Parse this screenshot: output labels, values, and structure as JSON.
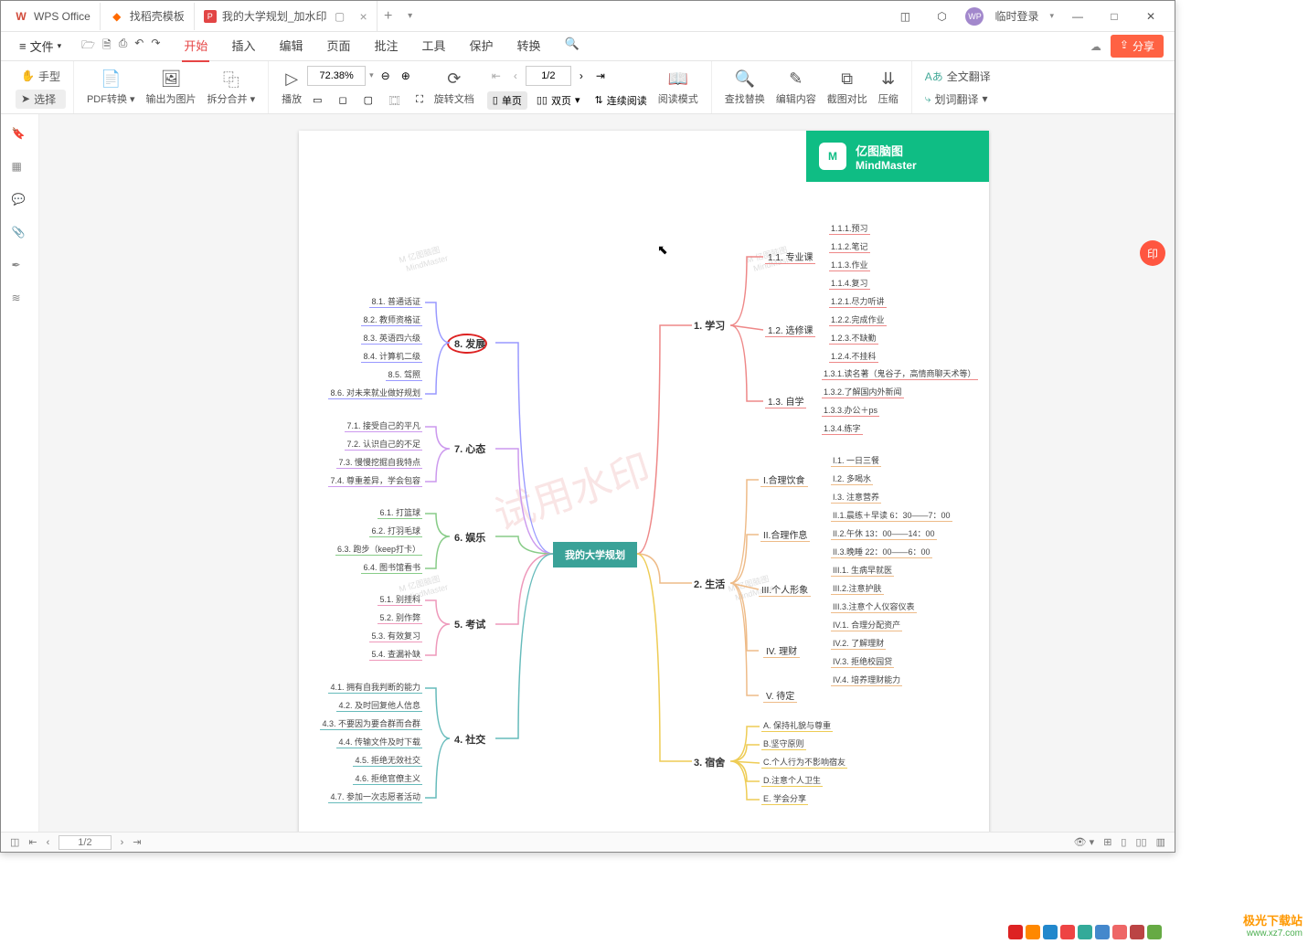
{
  "titlebar": {
    "tabs": [
      {
        "icon": "W",
        "label": "WPS Office",
        "icon_color": "#d14a3a"
      },
      {
        "icon": "◆",
        "label": "找稻壳模板",
        "icon_color": "#ff6a00"
      },
      {
        "icon": "P",
        "label": "我的大学规划_加水印",
        "icon_color": "#e24545",
        "active": true
      }
    ],
    "login": "临时登录"
  },
  "menu": {
    "file": "文件",
    "tabs": [
      "开始",
      "插入",
      "编辑",
      "页面",
      "批注",
      "工具",
      "保护",
      "转换"
    ],
    "active": "开始",
    "share": "分享"
  },
  "toolbar": {
    "hand": "手型",
    "select": "选择",
    "pdfconv": "PDF转换",
    "exportimg": "输出为图片",
    "splitmerge": "拆分合并",
    "play": "播放",
    "zoom": "72.38%",
    "page": "1/2",
    "rotate": "旋转文档",
    "single": "单页",
    "double": "双页",
    "continuous": "连续阅读",
    "readmode": "阅读模式",
    "findreplace": "查找替换",
    "editcontent": "编辑内容",
    "screenshot": "截图对比",
    "compress": "压缩",
    "fulltrans": "全文翻译",
    "wordtrans": "划词翻译"
  },
  "brand": {
    "line1": "亿图脑图",
    "line2": "MindMaster"
  },
  "mindmap": {
    "central": "我的大学规划",
    "right_mains": [
      {
        "label": "1. 学习"
      },
      {
        "label": "2. 生活"
      },
      {
        "label": "3. 宿舍"
      }
    ],
    "n1_subs": [
      "1.1. 专业课",
      "1.2. 选修课",
      "1.3. 自学"
    ],
    "n1_1": [
      "1.1.1.预习",
      "1.1.2.笔记",
      "1.1.3.作业",
      "1.1.4.复习"
    ],
    "n1_2": [
      "1.2.1.尽力听讲",
      "1.2.2.完成作业",
      "1.2.3.不缺勤",
      "1.2.4.不挂科"
    ],
    "n1_3": [
      "1.3.1.读名著（鬼谷子，高情商聊天术等）",
      "1.3.2.了解国内外新闻",
      "1.3.3.办公＋ps",
      "1.3.4.练字"
    ],
    "n2_subs": [
      "I.合理饮食",
      "II.合理作息",
      "III.个人形象",
      "IV. 理财",
      "V. 待定"
    ],
    "n2_I": [
      "I.1. 一日三餐",
      "I.2. 多喝水",
      "I.3. 注意营养"
    ],
    "n2_II": [
      "II.1.晨练＋早读 6：30——7：00",
      "II.2.午休 13：00——14：00",
      "II.3.晚睡 22：00——6：00"
    ],
    "n2_III": [
      "III.1. 生病早就医",
      "III.2.注意护肤",
      "III.3.注意个人仪容仪表"
    ],
    "n2_IV": [
      "IV.1. 合理分配资产",
      "IV.2. 了解理财",
      "IV.3. 拒绝校园贷",
      "IV.4. 培养理财能力"
    ],
    "n3_leaves": [
      "A. 保持礼貌与尊重",
      "B.坚守原则",
      "C.个人行为不影响宿友",
      "D.注意个人卫生",
      "E. 学会分享"
    ],
    "left_mains": [
      "8. 发展",
      "7. 心态",
      "6. 娱乐",
      "5. 考试",
      "4. 社交"
    ],
    "n8": [
      "8.1. 普通话证",
      "8.2. 教师资格证",
      "8.3. 英语四六级",
      "8.4. 计算机二级",
      "8.5. 驾照",
      "8.6. 对未来就业做好规划"
    ],
    "n7": [
      "7.1. 接受自己的平凡",
      "7.2. 认识自己的不足",
      "7.3. 慢慢挖掘自我特点",
      "7.4. 尊重差异，学会包容"
    ],
    "n6": [
      "6.1. 打篮球",
      "6.2. 打羽毛球",
      "6.3. 跑步（keep打卡）",
      "6.4. 图书馆看书"
    ],
    "n5": [
      "5.1. 别挂科",
      "5.2. 别作弊",
      "5.3. 有效复习",
      "5.4. 查漏补缺"
    ],
    "n4": [
      "4.1. 拥有自我判断的能力",
      "4.2. 及时回复他人信息",
      "4.3. 不要因为要合群而合群",
      "4.4. 传输文件及时下载",
      "4.5. 拒绝无效社交",
      "4.6. 拒绝官僚主义",
      "4.7. 参加一次志愿者活动"
    ]
  },
  "watermark": "试用水印",
  "wm_brand": "亿图脑图\nMindMaster",
  "statusbar": {
    "page": "1/2"
  },
  "site": {
    "l1": "极光下载站",
    "l2": "www.xz7.com"
  }
}
